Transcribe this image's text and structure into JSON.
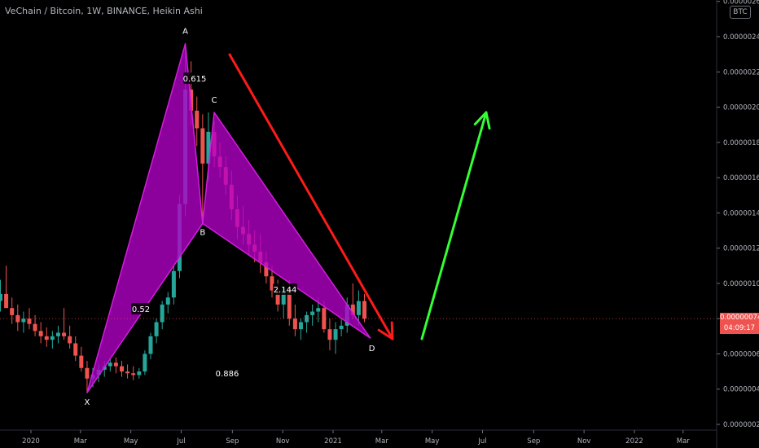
{
  "symbol": "VeChain / Bitcoin, 1W, BINANCE, Heikin Ashi",
  "axis_unit": "BTC",
  "current_price": "0.00000074",
  "countdown": "04:09:17",
  "colors": {
    "background": "#000000",
    "up_candle": "#26a69a",
    "down_candle": "#ef5350",
    "pattern_fill": "#b400c8",
    "pattern_edge": "#d21edc",
    "bear_arrow": "#ff1a1a",
    "bull_arrow": "#33ff33"
  },
  "chart_data": {
    "type": "candlestick",
    "title": "VeChain / Bitcoin, 1W, BINANCE, Heikin Ashi",
    "y_ticks": [
      "0.00000020",
      "0.00000040",
      "0.00000060",
      "0.00000080",
      "0.00000100",
      "0.00000120",
      "0.00000140",
      "0.00000160",
      "0.00000180",
      "0.00000200",
      "0.00000220",
      "0.00000240",
      "0.00000260"
    ],
    "y_tick_values": [
      20,
      40,
      60,
      80,
      100,
      120,
      140,
      160,
      180,
      200,
      220,
      240,
      260
    ],
    "y_unit_scale": "1e-8 BTC",
    "ylim": [
      16,
      262
    ],
    "x_ticks": [
      "2020",
      "Mar",
      "May",
      "Jul",
      "Sep",
      "Nov",
      "2021",
      "Mar",
      "May",
      "Jul",
      "Sep",
      "Nov",
      "2022",
      "Mar"
    ],
    "harmonic_points": [
      {
        "label": "X",
        "t": "2020-03-09",
        "value": 38
      },
      {
        "label": "A",
        "t": "2020-07-06",
        "value": 236
      },
      {
        "label": "B",
        "t": "2020-07-27",
        "value": 134
      },
      {
        "label": "C",
        "t": "2020-08-10",
        "value": 197
      },
      {
        "label": "D",
        "t": "2021-02-15",
        "value": 69
      }
    ],
    "ratios": [
      {
        "label": "0.615",
        "value": 0.615
      },
      {
        "label": "0.52",
        "value": 0.52
      },
      {
        "label": "2.144",
        "value": 2.144
      },
      {
        "label": "0.886",
        "value": 0.886
      }
    ],
    "candles": [
      {
        "t": "2019-11-25",
        "o": 90,
        "h": 102,
        "l": 84,
        "c": 94
      },
      {
        "t": "2019-12-02",
        "o": 94,
        "h": 110,
        "l": 88,
        "c": 86
      },
      {
        "t": "2019-12-09",
        "o": 86,
        "h": 92,
        "l": 77,
        "c": 82
      },
      {
        "t": "2019-12-16",
        "o": 82,
        "h": 88,
        "l": 73,
        "c": 78
      },
      {
        "t": "2019-12-23",
        "o": 78,
        "h": 84,
        "l": 72,
        "c": 80
      },
      {
        "t": "2019-12-30",
        "o": 80,
        "h": 86,
        "l": 74,
        "c": 77
      },
      {
        "t": "2020-01-06",
        "o": 77,
        "h": 82,
        "l": 70,
        "c": 73
      },
      {
        "t": "2020-01-13",
        "o": 73,
        "h": 78,
        "l": 66,
        "c": 70
      },
      {
        "t": "2020-01-20",
        "o": 70,
        "h": 75,
        "l": 64,
        "c": 68
      },
      {
        "t": "2020-01-27",
        "o": 68,
        "h": 73,
        "l": 63,
        "c": 70
      },
      {
        "t": "2020-02-03",
        "o": 70,
        "h": 76,
        "l": 66,
        "c": 72
      },
      {
        "t": "2020-02-10",
        "o": 72,
        "h": 86,
        "l": 68,
        "c": 70
      },
      {
        "t": "2020-02-17",
        "o": 70,
        "h": 76,
        "l": 63,
        "c": 66
      },
      {
        "t": "2020-02-24",
        "o": 66,
        "h": 70,
        "l": 56,
        "c": 59
      },
      {
        "t": "2020-03-02",
        "o": 59,
        "h": 64,
        "l": 50,
        "c": 52
      },
      {
        "t": "2020-03-09",
        "o": 52,
        "h": 56,
        "l": 38,
        "c": 46
      },
      {
        "t": "2020-03-16",
        "o": 46,
        "h": 52,
        "l": 41,
        "c": 48
      },
      {
        "t": "2020-03-23",
        "o": 48,
        "h": 54,
        "l": 44,
        "c": 51
      },
      {
        "t": "2020-03-30",
        "o": 51,
        "h": 56,
        "l": 47,
        "c": 53
      },
      {
        "t": "2020-04-06",
        "o": 53,
        "h": 58,
        "l": 50,
        "c": 55
      },
      {
        "t": "2020-04-13",
        "o": 55,
        "h": 58,
        "l": 49,
        "c": 53
      },
      {
        "t": "2020-04-20",
        "o": 53,
        "h": 56,
        "l": 47,
        "c": 50
      },
      {
        "t": "2020-04-27",
        "o": 50,
        "h": 54,
        "l": 46,
        "c": 49
      },
      {
        "t": "2020-05-04",
        "o": 49,
        "h": 53,
        "l": 45,
        "c": 48
      },
      {
        "t": "2020-05-11",
        "o": 48,
        "h": 52,
        "l": 46,
        "c": 50
      },
      {
        "t": "2020-05-18",
        "o": 50,
        "h": 62,
        "l": 48,
        "c": 60
      },
      {
        "t": "2020-05-25",
        "o": 60,
        "h": 72,
        "l": 57,
        "c": 70
      },
      {
        "t": "2020-06-01",
        "o": 70,
        "h": 80,
        "l": 66,
        "c": 78
      },
      {
        "t": "2020-06-08",
        "o": 78,
        "h": 90,
        "l": 74,
        "c": 88
      },
      {
        "t": "2020-06-15",
        "o": 88,
        "h": 95,
        "l": 83,
        "c": 92
      },
      {
        "t": "2020-06-22",
        "o": 92,
        "h": 110,
        "l": 88,
        "c": 107
      },
      {
        "t": "2020-06-29",
        "o": 107,
        "h": 150,
        "l": 103,
        "c": 145
      },
      {
        "t": "2020-07-06",
        "o": 145,
        "h": 236,
        "l": 138,
        "c": 210
      },
      {
        "t": "2020-07-13",
        "o": 210,
        "h": 226,
        "l": 190,
        "c": 198
      },
      {
        "t": "2020-07-20",
        "o": 198,
        "h": 206,
        "l": 178,
        "c": 188
      },
      {
        "t": "2020-07-27",
        "o": 188,
        "h": 196,
        "l": 134,
        "c": 168
      },
      {
        "t": "2020-08-03",
        "o": 168,
        "h": 197,
        "l": 158,
        "c": 186
      },
      {
        "t": "2020-08-10",
        "o": 186,
        "h": 192,
        "l": 166,
        "c": 172
      },
      {
        "t": "2020-08-17",
        "o": 172,
        "h": 180,
        "l": 160,
        "c": 166
      },
      {
        "t": "2020-08-24",
        "o": 166,
        "h": 172,
        "l": 150,
        "c": 156
      },
      {
        "t": "2020-08-31",
        "o": 156,
        "h": 164,
        "l": 136,
        "c": 142
      },
      {
        "t": "2020-09-07",
        "o": 142,
        "h": 150,
        "l": 125,
        "c": 132
      },
      {
        "t": "2020-09-14",
        "o": 132,
        "h": 144,
        "l": 122,
        "c": 128
      },
      {
        "t": "2020-09-21",
        "o": 128,
        "h": 136,
        "l": 116,
        "c": 122
      },
      {
        "t": "2020-09-28",
        "o": 122,
        "h": 130,
        "l": 112,
        "c": 118
      },
      {
        "t": "2020-10-05",
        "o": 118,
        "h": 128,
        "l": 106,
        "c": 112
      },
      {
        "t": "2020-10-12",
        "o": 112,
        "h": 118,
        "l": 100,
        "c": 104
      },
      {
        "t": "2020-10-19",
        "o": 104,
        "h": 110,
        "l": 92,
        "c": 96
      },
      {
        "t": "2020-10-26",
        "o": 96,
        "h": 102,
        "l": 84,
        "c": 88
      },
      {
        "t": "2020-11-02",
        "o": 88,
        "h": 100,
        "l": 80,
        "c": 97
      },
      {
        "t": "2020-11-09",
        "o": 97,
        "h": 102,
        "l": 76,
        "c": 80
      },
      {
        "t": "2020-11-16",
        "o": 80,
        "h": 88,
        "l": 70,
        "c": 74
      },
      {
        "t": "2020-11-23",
        "o": 74,
        "h": 80,
        "l": 68,
        "c": 78
      },
      {
        "t": "2020-11-30",
        "o": 78,
        "h": 84,
        "l": 72,
        "c": 82
      },
      {
        "t": "2020-12-07",
        "o": 82,
        "h": 88,
        "l": 76,
        "c": 84
      },
      {
        "t": "2020-12-14",
        "o": 84,
        "h": 92,
        "l": 78,
        "c": 86
      },
      {
        "t": "2020-12-21",
        "o": 86,
        "h": 90,
        "l": 72,
        "c": 74
      },
      {
        "t": "2020-12-28",
        "o": 74,
        "h": 80,
        "l": 62,
        "c": 68
      },
      {
        "t": "2021-01-04",
        "o": 68,
        "h": 78,
        "l": 60,
        "c": 74
      },
      {
        "t": "2021-01-11",
        "o": 74,
        "h": 80,
        "l": 70,
        "c": 76
      },
      {
        "t": "2021-01-18",
        "o": 76,
        "h": 92,
        "l": 72,
        "c": 88
      },
      {
        "t": "2021-01-25",
        "o": 88,
        "h": 100,
        "l": 80,
        "c": 82
      },
      {
        "t": "2021-02-01",
        "o": 82,
        "h": 96,
        "l": 76,
        "c": 90
      },
      {
        "t": "2021-02-08",
        "o": 90,
        "h": 94,
        "l": 78,
        "c": 80
      }
    ]
  }
}
